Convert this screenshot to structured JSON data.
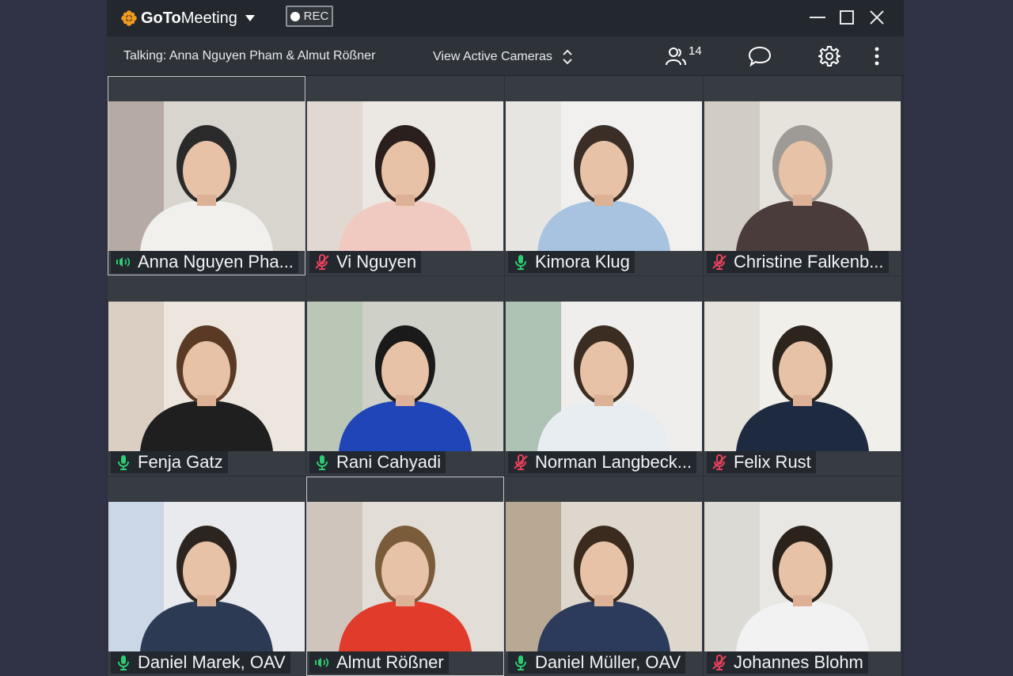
{
  "app": {
    "logo_bold": "GoTo",
    "logo_rest": "Meeting",
    "rec_label": "REC"
  },
  "toolbar": {
    "talking": "Talking: Anna Nguyen Pham & Almut Rößner",
    "view_cameras": "View Active Cameras",
    "participant_count": "14"
  },
  "colors": {
    "accent": "#f29a1e",
    "mic_on": "#2ecc71",
    "mic_muted": "#e8425b"
  },
  "participants": [
    {
      "name": "Anna Nguyen Pha...",
      "mic": "speaking",
      "active": true
    },
    {
      "name": "Vi Nguyen",
      "mic": "muted"
    },
    {
      "name": "Kimora Klug",
      "mic": "on"
    },
    {
      "name": "Christine Falkenb...",
      "mic": "muted"
    },
    {
      "name": "Fenja Gatz",
      "mic": "on"
    },
    {
      "name": "Rani Cahyadi",
      "mic": "on"
    },
    {
      "name": "Norman Langbeck...",
      "mic": "muted"
    },
    {
      "name": "Felix Rust",
      "mic": "muted"
    },
    {
      "name": "Daniel Marek, OAV",
      "mic": "on"
    },
    {
      "name": "Almut Rößner",
      "mic": "speaking",
      "active": true
    },
    {
      "name": "Daniel Müller, OAV",
      "mic": "on"
    },
    {
      "name": "Johannes Blohm",
      "mic": "muted"
    }
  ]
}
